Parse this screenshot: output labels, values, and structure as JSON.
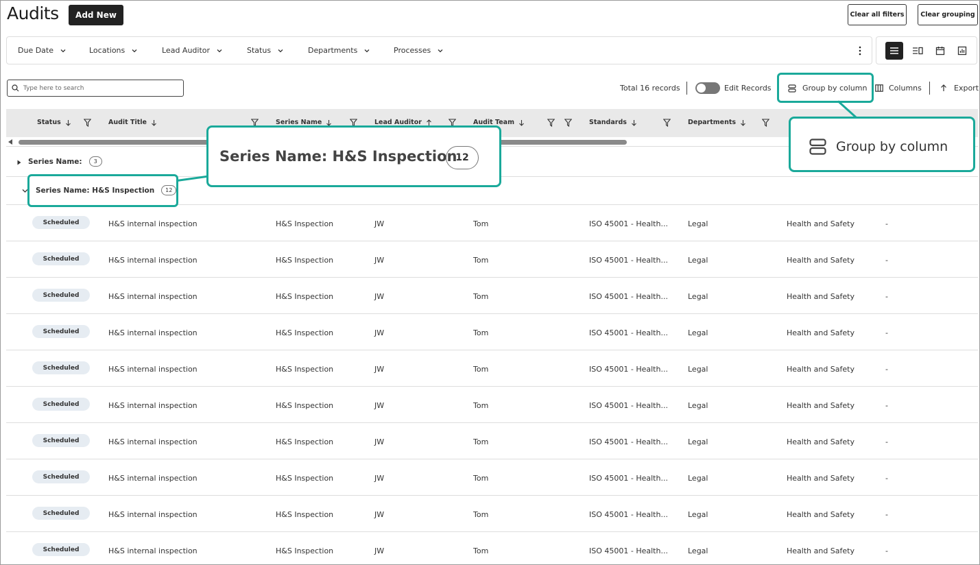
{
  "page": {
    "title": "Audits",
    "add_new_label": "Add New",
    "clear_filters_label": "Clear all filters",
    "clear_grouping_label": "Clear grouping"
  },
  "filters": [
    {
      "label": "Due Date"
    },
    {
      "label": "Locations"
    },
    {
      "label": "Lead Auditor"
    },
    {
      "label": "Status"
    },
    {
      "label": "Departments"
    },
    {
      "label": "Processes"
    }
  ],
  "view_modes": [
    "list-icon",
    "board-icon",
    "calendar-icon",
    "report-icon"
  ],
  "search": {
    "placeholder": "Type here to search"
  },
  "toolbar": {
    "total_records": "Total 16 records",
    "edit_records_label": "Edit Records",
    "group_by_label": "Group by column",
    "columns_label": "Columns",
    "export_label": "Export"
  },
  "columns": [
    {
      "label": "Status",
      "sort": "down"
    },
    {
      "label": "Audit Title",
      "sort": "down"
    },
    {
      "label": "Series Name",
      "sort": "down"
    },
    {
      "label": "Lead Auditor",
      "sort": "up"
    },
    {
      "label": "Audit Team",
      "sort": "down"
    },
    {
      "label": "Standards",
      "sort": "down"
    },
    {
      "label": "Departments",
      "sort": "down"
    }
  ],
  "groups": [
    {
      "label": "Series Name:",
      "count": "3",
      "expanded": false
    },
    {
      "label": "Series Name: H&S Inspection",
      "count": "12",
      "expanded": true
    }
  ],
  "rows": [
    {
      "status": "Scheduled",
      "title": "H&S internal inspection",
      "series": "H&S Inspection",
      "lead": "JW",
      "team": "Tom",
      "standards": "ISO 45001 - Health...",
      "departments": "Legal",
      "processes": "Health and Safety",
      "extra": "-"
    },
    {
      "status": "Scheduled",
      "title": "H&S internal inspection",
      "series": "H&S Inspection",
      "lead": "JW",
      "team": "Tom",
      "standards": "ISO 45001 - Health...",
      "departments": "Legal",
      "processes": "Health and Safety",
      "extra": "-"
    },
    {
      "status": "Scheduled",
      "title": "H&S internal inspection",
      "series": "H&S Inspection",
      "lead": "JW",
      "team": "Tom",
      "standards": "ISO 45001 - Health...",
      "departments": "Legal",
      "processes": "Health and Safety",
      "extra": "-"
    },
    {
      "status": "Scheduled",
      "title": "H&S internal inspection",
      "series": "H&S Inspection",
      "lead": "JW",
      "team": "Tom",
      "standards": "ISO 45001 - Health...",
      "departments": "Legal",
      "processes": "Health and Safety",
      "extra": "-"
    },
    {
      "status": "Scheduled",
      "title": "H&S internal inspection",
      "series": "H&S Inspection",
      "lead": "JW",
      "team": "Tom",
      "standards": "ISO 45001 - Health...",
      "departments": "Legal",
      "processes": "Health and Safety",
      "extra": "-"
    },
    {
      "status": "Scheduled",
      "title": "H&S internal inspection",
      "series": "H&S Inspection",
      "lead": "JW",
      "team": "Tom",
      "standards": "ISO 45001 - Health...",
      "departments": "Legal",
      "processes": "Health and Safety",
      "extra": "-"
    },
    {
      "status": "Scheduled",
      "title": "H&S internal inspection",
      "series": "H&S Inspection",
      "lead": "JW",
      "team": "Tom",
      "standards": "ISO 45001 - Health...",
      "departments": "Legal",
      "processes": "Health and Safety",
      "extra": "-"
    },
    {
      "status": "Scheduled",
      "title": "H&S internal inspection",
      "series": "H&S Inspection",
      "lead": "JW",
      "team": "Tom",
      "standards": "ISO 45001 - Health...",
      "departments": "Legal",
      "processes": "Health and Safety",
      "extra": "-"
    },
    {
      "status": "Scheduled",
      "title": "H&S internal inspection",
      "series": "H&S Inspection",
      "lead": "JW",
      "team": "Tom",
      "standards": "ISO 45001 - Health...",
      "departments": "Legal",
      "processes": "Health and Safety",
      "extra": "-"
    },
    {
      "status": "Scheduled",
      "title": "H&S internal inspection",
      "series": "H&S Inspection",
      "lead": "JW",
      "team": "Tom",
      "standards": "ISO 45001 - Health...",
      "departments": "Legal",
      "processes": "Health and Safety",
      "extra": "-"
    }
  ],
  "callouts": {
    "series_label": "Series Name: H&S Inspection",
    "series_count": "12",
    "group_label": "Group by column"
  },
  "colors": {
    "accent": "#1aa99a",
    "dark": "#222222",
    "badge_bg": "#e6ecf2"
  }
}
